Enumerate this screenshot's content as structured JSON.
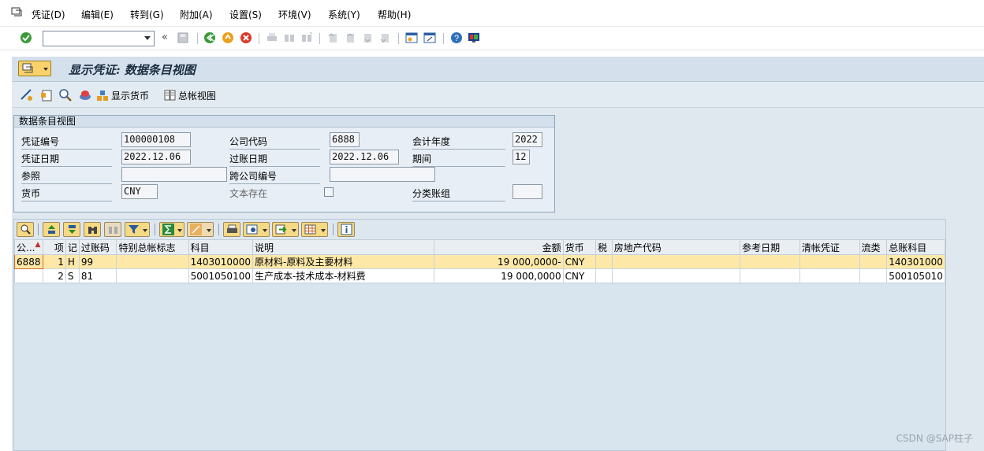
{
  "menu": {
    "items": [
      "凭证(D)",
      "编辑(E)",
      "转到(G)",
      "附加(A)",
      "设置(S)",
      "环境(V)",
      "系统(Y)",
      "帮助(H)"
    ]
  },
  "toolbar": {
    "command_value": "",
    "back_chevron": "«"
  },
  "screen": {
    "title": "显示凭证: 数据条目视图"
  },
  "app_toolbar": {
    "show_currency": "显示货币",
    "gl_view": "总帐视图"
  },
  "header": {
    "group_title": "数据条目视图",
    "doc_number_label": "凭证编号",
    "doc_number": "100000108",
    "company_code_label": "公司代码",
    "company_code": "6888",
    "fiscal_year_label": "会计年度",
    "fiscal_year": "2022",
    "doc_date_label": "凭证日期",
    "doc_date": "2022.12.06",
    "posting_date_label": "过账日期",
    "posting_date": "2022.12.06",
    "period_label": "期间",
    "period": "12",
    "reference_label": "参照",
    "reference": "",
    "cross_cc_label": "跨公司编号",
    "cross_cc": "",
    "currency_label": "货币",
    "currency": "CNY",
    "text_exists_label": "文本存在",
    "ledger_group_label": "分类账组",
    "ledger_group": ""
  },
  "grid": {
    "columns": [
      "公...",
      "项",
      "记",
      "过账码",
      "特别总帐标志",
      "科目",
      "说明",
      "金额",
      "货币",
      "税",
      "房地产代码",
      "参考日期",
      "清帐凭证",
      "流类",
      "总账科目"
    ],
    "rows": [
      [
        "6888",
        "1",
        "H",
        "99",
        "",
        "1403010000",
        "原材料-原料及主要材料",
        "19 000,0000-",
        "CNY",
        "",
        "",
        "",
        "",
        "",
        "140301000"
      ],
      [
        "",
        "2",
        "S",
        "81",
        "",
        "5001050100",
        "生产成本-技术成本-材料费",
        "19 000,0000",
        "CNY",
        "",
        "",
        "",
        "",
        "",
        "500105010"
      ]
    ]
  },
  "watermark": "CSDN @SAP柱子"
}
